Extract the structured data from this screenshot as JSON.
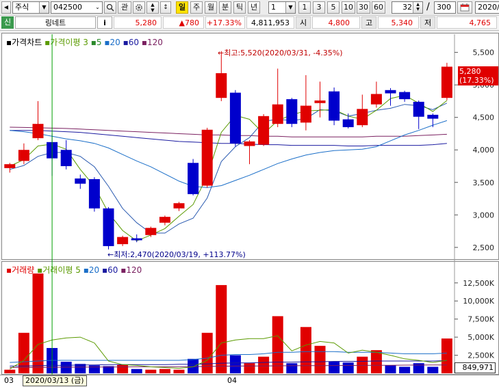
{
  "toolbar": {
    "market_select": "주식",
    "code_input": "042500",
    "search_icon": "search-icon",
    "favorite_label": "관",
    "period_buttons": [
      "일",
      "주",
      "월",
      "분",
      "틱",
      "년"
    ],
    "interval_select": "1",
    "interval_buttons": [
      "1",
      "3",
      "5",
      "10",
      "30",
      "60"
    ],
    "count_value": "32",
    "separator": "/",
    "total_value": "300",
    "date_value": "2020/"
  },
  "quote": {
    "badge": "신",
    "name": "링네트",
    "info_label": "i",
    "price": "5,280",
    "change": "▲780",
    "change_pct": "+17.33%",
    "volume": "4,811,953",
    "open_label": "시",
    "open": "4,800",
    "high_label": "고",
    "high": "5,340",
    "low_label": "저",
    "low": "4,765"
  },
  "colors": {
    "up": "#e00000",
    "down": "#0000cc",
    "ma5": "#5a9a00",
    "ma20": "#1a6ec8",
    "ma60": "#1a1aa0",
    "ma120": "#7a2060",
    "accent_price": "#e00000"
  },
  "price_legend": {
    "title": "가격차트",
    "ma_label": "가격이평",
    "periods": [
      "3",
      "5",
      "20",
      "60",
      "120"
    ]
  },
  "volume_legend": {
    "title": "거래량",
    "ma_label": "거래이평",
    "periods": [
      "5",
      "20",
      "60",
      "120"
    ]
  },
  "annotations": {
    "high": "최고:5,520(2020/03/31, -4.35%)",
    "low": "최저:2,470(2020/03/19, +113.77%)",
    "current_price": "5,280",
    "current_pct": "(17.33%)",
    "current_volume": "849,971"
  },
  "x_axis": {
    "labels": [
      "03",
      "04"
    ],
    "cursor_date": "2020/03/13 (금)"
  },
  "chart_data": [
    {
      "type": "candlestick",
      "price_ticks": [
        2500,
        3000,
        3500,
        4000,
        4500,
        5000,
        5500
      ],
      "price_tick_labels": [
        "2,500",
        "3,000",
        "3,500",
        "4,000",
        "4,500",
        "5,000",
        "5,500"
      ],
      "ylim": [
        2330,
        5780
      ],
      "candles": [
        {
          "o": 3720,
          "h": 3800,
          "l": 3650,
          "c": 3780
        },
        {
          "o": 3830,
          "h": 4100,
          "l": 3780,
          "c": 4000
        },
        {
          "o": 4180,
          "h": 4750,
          "l": 4150,
          "c": 4400
        },
        {
          "o": 4120,
          "h": 4250,
          "l": 3600,
          "c": 3870
        },
        {
          "o": 4000,
          "h": 4150,
          "l": 3700,
          "c": 3750
        },
        {
          "o": 3560,
          "h": 3620,
          "l": 3400,
          "c": 3480
        },
        {
          "o": 3550,
          "h": 3580,
          "l": 3050,
          "c": 3100
        },
        {
          "o": 3100,
          "h": 3120,
          "l": 2470,
          "c": 2520
        },
        {
          "o": 2550,
          "h": 2680,
          "l": 2520,
          "c": 2660
        },
        {
          "o": 2640,
          "h": 2700,
          "l": 2580,
          "c": 2610
        },
        {
          "o": 2690,
          "h": 2820,
          "l": 2660,
          "c": 2800
        },
        {
          "o": 2880,
          "h": 2990,
          "l": 2840,
          "c": 2970
        },
        {
          "o": 3100,
          "h": 3200,
          "l": 3060,
          "c": 3180
        },
        {
          "o": 3800,
          "h": 3860,
          "l": 3300,
          "c": 3320
        },
        {
          "o": 3450,
          "h": 4340,
          "l": 3420,
          "c": 4310
        },
        {
          "o": 4800,
          "h": 5520,
          "l": 4750,
          "c": 5180
        },
        {
          "o": 4880,
          "h": 4920,
          "l": 4050,
          "c": 4100
        },
        {
          "o": 4060,
          "h": 4150,
          "l": 3780,
          "c": 4130
        },
        {
          "o": 4080,
          "h": 4550,
          "l": 4060,
          "c": 4520
        },
        {
          "o": 4400,
          "h": 5250,
          "l": 4350,
          "c": 4700
        },
        {
          "o": 4780,
          "h": 4800,
          "l": 4350,
          "c": 4400
        },
        {
          "o": 4420,
          "h": 5150,
          "l": 4300,
          "c": 4680
        },
        {
          "o": 4720,
          "h": 5050,
          "l": 4500,
          "c": 4760
        },
        {
          "o": 4900,
          "h": 4960,
          "l": 4380,
          "c": 4450
        },
        {
          "o": 4470,
          "h": 4560,
          "l": 4330,
          "c": 4350
        },
        {
          "o": 4380,
          "h": 4850,
          "l": 4350,
          "c": 4630
        },
        {
          "o": 4700,
          "h": 5050,
          "l": 4650,
          "c": 4860
        },
        {
          "o": 4920,
          "h": 4950,
          "l": 4680,
          "c": 4870
        },
        {
          "o": 4890,
          "h": 4910,
          "l": 4740,
          "c": 4780
        },
        {
          "o": 4740,
          "h": 4760,
          "l": 4320,
          "c": 4510
        },
        {
          "o": 4540,
          "h": 4560,
          "l": 4350,
          "c": 4480
        },
        {
          "o": 4800,
          "h": 5340,
          "l": 4765,
          "c": 5280
        }
      ],
      "ma3": [
        3750,
        3850,
        4060,
        4090,
        4010,
        3700,
        3440,
        3030,
        2760,
        2600,
        2690,
        2790,
        2980,
        3160,
        3600,
        4270,
        4530,
        4470,
        4250,
        4450,
        4540,
        4600,
        4610,
        4620,
        4520,
        4470,
        4610,
        4790,
        4840,
        4720,
        4590,
        4760
      ],
      "ma5": [
        3700,
        3760,
        3900,
        3960,
        3960,
        3900,
        3740,
        3440,
        3100,
        2880,
        2720,
        2720,
        2860,
        2950,
        3260,
        3820,
        4050,
        4190,
        4440,
        4470,
        4450,
        4480,
        4620,
        4600,
        4520,
        4560,
        4610,
        4640,
        4700,
        4680,
        4620,
        4720
      ],
      "ma20": [
        4300,
        4280,
        4250,
        4210,
        4170,
        4140,
        4100,
        4030,
        3930,
        3830,
        3740,
        3630,
        3520,
        3440,
        3420,
        3450,
        3530,
        3610,
        3700,
        3790,
        3860,
        3920,
        3960,
        3990,
        4000,
        4010,
        4050,
        4140,
        4230,
        4300,
        4380,
        4450
      ],
      "ma60": [
        4300,
        4300,
        4300,
        4290,
        4280,
        4270,
        4250,
        4230,
        4210,
        4190,
        4170,
        4150,
        4130,
        4120,
        4110,
        4100,
        4100,
        4090,
        4080,
        4080,
        4070,
        4070,
        4070,
        4070,
        4060,
        4060,
        4070,
        4070,
        4070,
        4070,
        4080,
        4100
      ],
      "ma120": [
        4350,
        4345,
        4340,
        4335,
        4330,
        4320,
        4310,
        4300,
        4290,
        4280,
        4270,
        4260,
        4250,
        4240,
        4230,
        4230,
        4220,
        4220,
        4210,
        4210,
        4200,
        4200,
        4200,
        4200,
        4200,
        4200,
        4210,
        4210,
        4210,
        4220,
        4230,
        4240
      ]
    },
    {
      "type": "bar",
      "volume_ticks": [
        2500000,
        5000000,
        7500000,
        10000000,
        12500000
      ],
      "volume_tick_labels": [
        "2,500K",
        "5,000K",
        "7,500K",
        "10,000K",
        "12,500K"
      ],
      "ylim": [
        0,
        13800000
      ],
      "values": [
        500000,
        5600000,
        13800000,
        3500000,
        1600000,
        1300000,
        1100000,
        1000000,
        1200000,
        600000,
        500000,
        600000,
        500000,
        2000000,
        5600000,
        12200000,
        2500000,
        1400000,
        2300000,
        7900000,
        1400000,
        6400000,
        3800000,
        1600000,
        1500000,
        2300000,
        3200000,
        1100000,
        900000,
        1400000,
        900000,
        4811953
      ],
      "ma5": [
        600000,
        1800000,
        4000000,
        4600000,
        4900000,
        5000000,
        4200000,
        1700000,
        1200000,
        1100000,
        900000,
        800000,
        700000,
        900000,
        1800000,
        4200000,
        4600000,
        4800000,
        4800000,
        5200000,
        3100000,
        3900000,
        4400000,
        4200000,
        2800000,
        3200000,
        2900000,
        2500000,
        2000000,
        1800000,
        1500000,
        1800000
      ],
      "ma20": [
        1500000,
        1600000,
        1700000,
        1800000,
        1800000,
        1800000,
        1800000,
        1800000,
        1800000,
        1800000,
        1800000,
        1800000,
        1800000,
        1900000,
        2100000,
        2500000,
        2600000,
        2600000,
        2700000,
        2900000,
        2900000,
        3000000,
        3000000,
        3000000,
        2900000,
        2900000,
        2900000,
        2800000,
        2700000,
        2700000,
        2700000,
        2800000
      ],
      "ma60": [
        1000000,
        1000000,
        1050000,
        1100000,
        1100000,
        1150000,
        1150000,
        1200000,
        1200000,
        1200000,
        1200000,
        1200000,
        1250000,
        1250000,
        1300000,
        1400000,
        1450000,
        1450000,
        1500000,
        1550000,
        1550000,
        1600000,
        1600000,
        1650000,
        1650000,
        1650000,
        1700000,
        1700000,
        1700000,
        1700000,
        1700000,
        1750000
      ],
      "ma120": [
        800000,
        800000,
        820000,
        840000,
        850000,
        860000,
        870000,
        880000,
        890000,
        900000,
        900000,
        910000,
        920000,
        930000,
        950000,
        980000,
        1000000,
        1010000,
        1020000,
        1040000,
        1050000,
        1060000,
        1070000,
        1080000,
        1090000,
        1100000,
        1110000,
        1120000,
        1130000,
        1140000,
        1150000,
        1160000
      ]
    }
  ]
}
